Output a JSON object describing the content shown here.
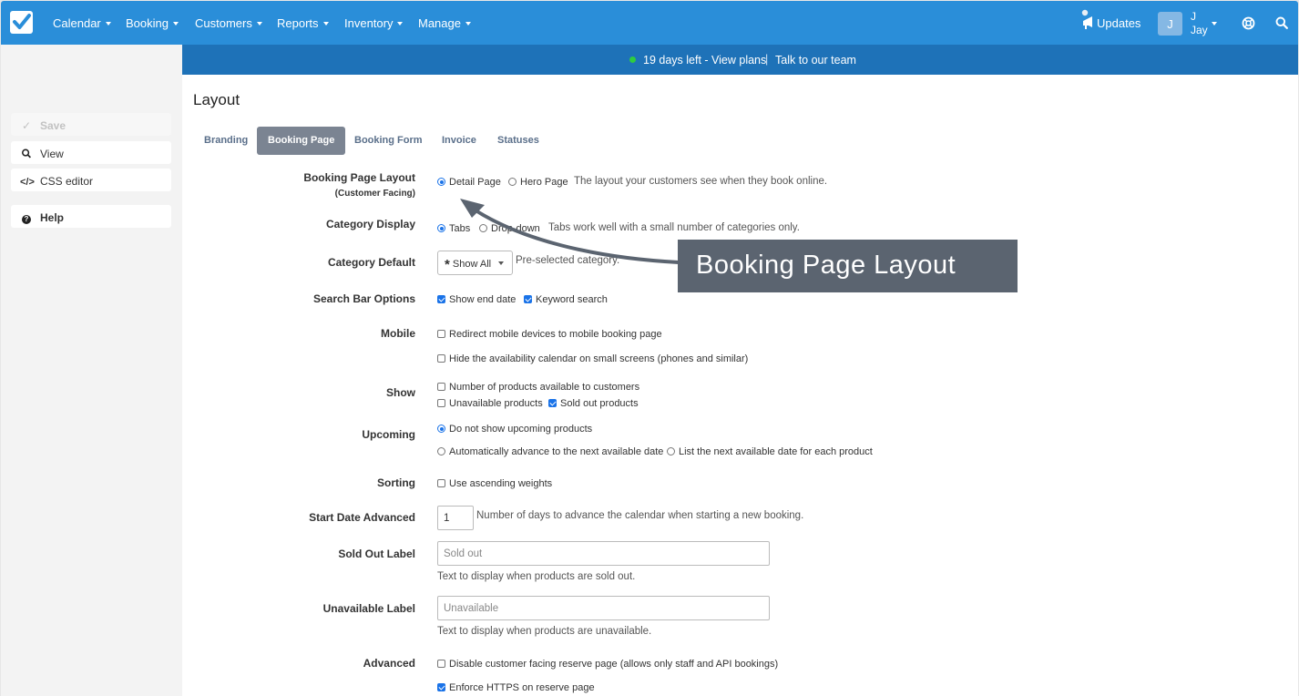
{
  "topnav": {
    "items": [
      "Calendar",
      "Booking",
      "Customers",
      "Reports",
      "Inventory",
      "Manage"
    ],
    "updates_label": "Updates",
    "user_initial": "J",
    "user_line1": "J",
    "user_line2": "Jay"
  },
  "banner": {
    "trial_text": "19 days left - View plans",
    "separator": "|",
    "talk_text": "Talk to our team",
    "status_color": "#2ecc40"
  },
  "sidebar": {
    "save": "Save",
    "view": "View",
    "css_editor": "CSS editor",
    "help": "Help"
  },
  "page": {
    "title": "Layout",
    "tabs": [
      "Branding",
      "Booking Page",
      "Booking Form",
      "Invoice",
      "Statuses"
    ],
    "active_tab": "Booking Page"
  },
  "form": {
    "booking_layout": {
      "label": "Booking Page Layout",
      "sublabel": "(Customer Facing)",
      "option1": "Detail Page",
      "option2": "Hero Page",
      "hint": "The layout your customers see when they book online."
    },
    "category_display": {
      "label": "Category Display",
      "option1": "Tabs",
      "option2": "Drop-down",
      "hint": "Tabs work well with a small number of categories only."
    },
    "category_default": {
      "label": "Category Default",
      "value": "Show All",
      "hint": "Pre-selected category."
    },
    "search_bar": {
      "label": "Search Bar Options",
      "option1": "Show end date",
      "option2": "Keyword search"
    },
    "mobile": {
      "label": "Mobile",
      "option1": "Redirect mobile devices to mobile booking page",
      "option2": "Hide the availability calendar on small screens (phones and similar)"
    },
    "show": {
      "label": "Show",
      "option1": "Number of products available to customers",
      "option2": "Unavailable products",
      "option3": "Sold out products"
    },
    "upcoming": {
      "label": "Upcoming",
      "option1": "Do not show upcoming products",
      "option2": "Automatically advance to the next available date",
      "option3": "List the next available date for each product"
    },
    "sorting": {
      "label": "Sorting",
      "option1": "Use ascending weights"
    },
    "start_date": {
      "label": "Start Date Advanced",
      "value": "1",
      "hint": "Number of days to advance the calendar when starting a new booking."
    },
    "sold_out": {
      "label": "Sold Out Label",
      "placeholder": "Sold out",
      "hint": "Text to display when products are sold out."
    },
    "unavailable": {
      "label": "Unavailable Label",
      "placeholder": "Unavailable",
      "hint": "Text to display when products are unavailable."
    },
    "advanced": {
      "label": "Advanced",
      "option1": "Disable customer facing reserve page (allows only staff and API bookings)",
      "option2": "Enforce HTTPS on reserve page"
    }
  },
  "annotation": {
    "callout_text": "Booking Page Layout"
  }
}
